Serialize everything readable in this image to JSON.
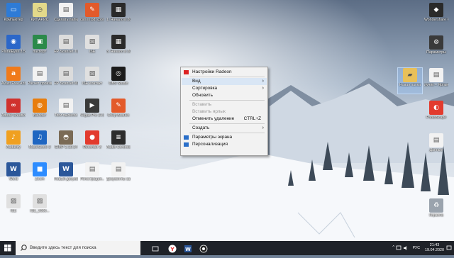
{
  "desktop": {
    "icons": [
      {
        "label": "Компьютер",
        "color": "#2e7bd6",
        "glyph": "▭",
        "icon": "computer-icon"
      },
      {
        "label": "КИПАРИС",
        "color": "#e3d98a",
        "glyph": "◷",
        "icon": "clock-icon"
      },
      {
        "label": "Сделать папки",
        "color": "#f2f2f2",
        "glyph": "▤",
        "icon": "document-icon"
      },
      {
        "label": "canon pdf (ролики)",
        "color": "#e35a2a",
        "glyph": "✎",
        "icon": "pdf-icon"
      },
      {
        "label": "1. Начало в 2020...",
        "color": "#2a2a2a",
        "glyph": "▦",
        "icon": "video-file-icon"
      },
      {
        "label": "PluralEyes 3.5",
        "color": "#2b67c9",
        "glyph": "◉",
        "icon": "pluraleyes-icon"
      },
      {
        "label": "паспорт",
        "color": "#2b8a4a",
        "glyph": "▣",
        "icon": "passport-icon"
      },
      {
        "label": "HP ScanJet TLE...",
        "color": "#dcdcdc",
        "glyph": "▤",
        "icon": "scanner-icon"
      },
      {
        "label": "ISE",
        "color": "#e0e0e0",
        "glyph": "▨",
        "icon": "ise-icon"
      },
      {
        "label": "3. Начало в 2020...",
        "color": "#2a2a2a",
        "glyph": "▦",
        "icon": "video-file-icon"
      },
      {
        "label": "Avast Free Antivirus",
        "color": "#f07a1a",
        "glyph": "a",
        "icon": "avast-icon"
      },
      {
        "label": "Расчет производ...",
        "color": "#f2f2f2",
        "glyph": "▤",
        "icon": "document-icon"
      },
      {
        "label": "HP ScanJet M100 M200",
        "color": "#dcdcdc",
        "glyph": "▤",
        "icon": "scanner-icon"
      },
      {
        "label": "ISE Контакт",
        "color": "#e0e0e0",
        "glyph": "▨",
        "icon": "ise-icon"
      },
      {
        "label": "OBS Studio",
        "color": "#1b1b1b",
        "glyph": "◎",
        "icon": "obs-icon"
      },
      {
        "label": "Adobe Creative...",
        "color": "#d0312d",
        "glyph": "∞",
        "icon": "adobe-cc-icon"
      },
      {
        "label": "Blender",
        "color": "#e87d0d",
        "glyph": "◍",
        "icon": "blender-icon"
      },
      {
        "label": "Тяги пылесос",
        "color": "#f2f2f2",
        "glyph": "▤",
        "icon": "document-icon"
      },
      {
        "label": "Vegas Pro 14.0",
        "color": "#3a3a3a",
        "glyph": "▶",
        "icon": "vegas-icon"
      },
      {
        "label": "Сбер Бизнес",
        "color": "#e35a2a",
        "glyph": "✎",
        "icon": "pdf-icon"
      },
      {
        "label": "Audacity",
        "color": "#f0a020",
        "glyph": "♪",
        "icon": "audacity-icon"
      },
      {
        "label": "MuseScore 3",
        "color": "#1f66c1",
        "glyph": "♫",
        "icon": "musescore-icon"
      },
      {
        "label": "GIMP 2.10.14",
        "color": "#7a6a55",
        "glyph": "◓",
        "icon": "gimp-icon"
      },
      {
        "label": "Recorder 3",
        "color": "#e23b2e",
        "glyph": "●",
        "icon": "recorder-icon"
      },
      {
        "label": "Audio Controls",
        "color": "#2d2d2d",
        "glyph": "≡",
        "icon": "audio-controls-icon"
      },
      {
        "label": "Word",
        "color": "#2b579a",
        "glyph": "W",
        "icon": "word-icon"
      },
      {
        "label": "Zoom",
        "color": "#2d8cff",
        "glyph": "■",
        "icon": "zoom-icon"
      },
      {
        "label": "Новый документ...",
        "color": "#2b579a",
        "glyph": "W",
        "icon": "word-icon"
      },
      {
        "label": "Регистрация...",
        "color": "#f2f2f2",
        "glyph": "▤",
        "icon": "document-icon"
      },
      {
        "label": "Документы заявки",
        "color": "#f2f2f2",
        "glyph": "▤",
        "icon": "document-icon"
      },
      {
        "label": "ISE",
        "color": "#e0e0e0",
        "glyph": "▨",
        "icon": "ise-icon"
      },
      {
        "label": "ISE_3000...",
        "color": "#e0e0e0",
        "glyph": "▨",
        "icon": "ise-icon"
      }
    ],
    "right_icons": [
      {
        "label": "Wondershare Filmora9",
        "color": "#2a2a2a",
        "glyph": "◆",
        "icon": "filmora-icon"
      },
      {
        "label": "Параметры",
        "color": "#3a3a3a",
        "glyph": "⚙",
        "icon": "settings-icon"
      },
      {
        "label": "Новая папка",
        "color": "#e8c05a",
        "glyph": "▰",
        "icon": "folder-icon"
      },
      {
        "label": "лучик – Ярлык",
        "color": "#f2f2f2",
        "glyph": "▤",
        "icon": "shortcut-icon"
      },
      {
        "label": "PhotoScape",
        "color": "#e23b2e",
        "glyph": "◐",
        "icon": "photoscape-icon"
      },
      {
        "label": "Данные",
        "color": "#f2f2f2",
        "glyph": "▤",
        "icon": "document-icon"
      },
      {
        "label": "Корзина",
        "color": "#9aa3ad",
        "glyph": "♻",
        "icon": "recycle-bin-icon"
      }
    ]
  },
  "context_menu": {
    "items": [
      {
        "label": "Настройки Radeon",
        "type": "item",
        "icon": true
      },
      {
        "type": "sep"
      },
      {
        "label": "Вид",
        "type": "item",
        "arrow": "›",
        "hl": true
      },
      {
        "label": "Сортировка",
        "type": "item",
        "arrow": "›"
      },
      {
        "label": "Обновить",
        "type": "item"
      },
      {
        "type": "sep"
      },
      {
        "label": "Вставить",
        "type": "item",
        "disabled": true
      },
      {
        "label": "Вставить ярлык",
        "type": "item",
        "disabled": true
      },
      {
        "label": "Отменить удаление",
        "type": "item",
        "shortcut": "CTRL+Z"
      },
      {
        "type": "sep"
      },
      {
        "label": "Создать",
        "type": "item",
        "arrow": "›"
      },
      {
        "type": "sep"
      },
      {
        "label": "Параметры экрана",
        "type": "item",
        "icon": true
      },
      {
        "label": "Персонализация",
        "type": "item",
        "icon": true
      }
    ]
  },
  "taskbar": {
    "search_placeholder": "Введите здесь текст для поиска",
    "tray_lang": "РУС",
    "time": "21:43",
    "date": "19.04.2020"
  },
  "colors": {
    "taskbar": "#1f2228",
    "accent": "#0078d7"
  }
}
